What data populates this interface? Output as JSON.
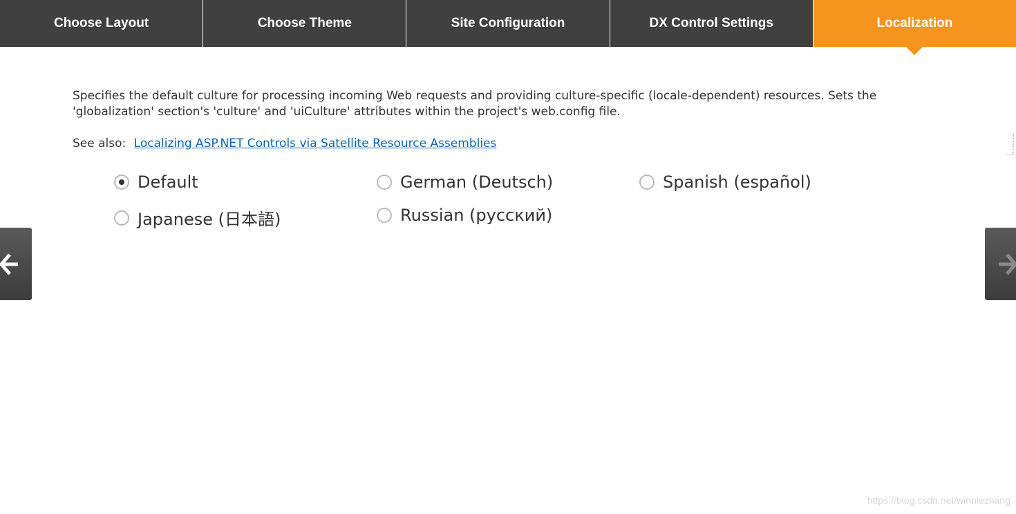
{
  "tabs": [
    {
      "label": "Choose Layout",
      "active": false
    },
    {
      "label": "Choose Theme",
      "active": false
    },
    {
      "label": "Site Configuration",
      "active": false
    },
    {
      "label": "DX Control Settings",
      "active": false
    },
    {
      "label": "Localization",
      "active": true
    }
  ],
  "colors": {
    "tab_background": "#404040",
    "tab_active": "#f7941d",
    "link": "#0a63b3",
    "text": "#333333"
  },
  "content": {
    "description": "Specifies the default culture for processing incoming Web requests and providing culture-specific (locale-dependent) resources. Sets the 'globalization' section's 'culture' and 'uiCulture' attributes within the project's web.config file.",
    "see_also_label": "See also:",
    "see_also_link": "Localizing ASP.NET Controls via Satellite Resource Assemblies"
  },
  "cultures": {
    "selected": "Default",
    "options": [
      {
        "label": "Default",
        "checked": true
      },
      {
        "label": "German (Deutsch)",
        "checked": false
      },
      {
        "label": "Spanish (español)",
        "checked": false
      },
      {
        "label": "Japanese (日本語)",
        "checked": false
      },
      {
        "label": "Russian (русский)",
        "checked": false
      }
    ]
  },
  "navigation": {
    "prev_icon": "arrow-left-icon",
    "next_icon": "arrow-right-icon"
  },
  "watermark": "https://blog.csdn.net/winniezhang"
}
